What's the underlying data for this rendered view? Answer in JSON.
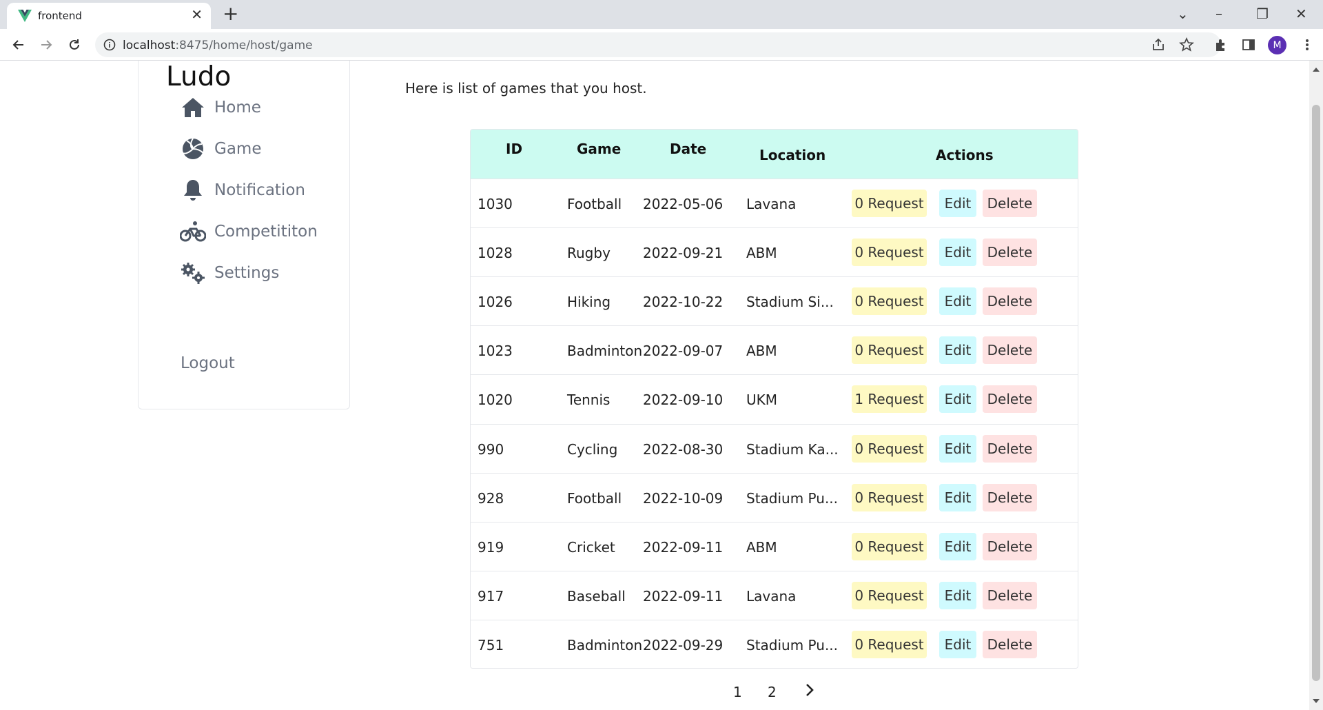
{
  "browser": {
    "tab_title": "frontend",
    "url_host": "localhost",
    "url_path": ":8475/home/host/game",
    "profile_initial": "M"
  },
  "sidebar": {
    "brand": "Ludo",
    "items": [
      {
        "label": "Home",
        "icon": "home-icon"
      },
      {
        "label": "Game",
        "icon": "volleyball-icon"
      },
      {
        "label": "Notification",
        "icon": "bell-icon"
      },
      {
        "label": "Competititon",
        "icon": "bicycle-icon"
      },
      {
        "label": "Settings",
        "icon": "gears-icon"
      }
    ],
    "logout": "Logout"
  },
  "main": {
    "intro": "Here is list of games that you host."
  },
  "table": {
    "headers": {
      "id": "ID",
      "game": "Game",
      "date": "Date",
      "location": "Location",
      "actions": "Actions"
    },
    "rows": [
      {
        "id": "1030",
        "game": "Football",
        "date": "2022-05-06",
        "location": "Lavana",
        "requests": "0 Request"
      },
      {
        "id": "1028",
        "game": "Rugby",
        "date": "2022-09-21",
        "location": "ABM",
        "requests": "0 Request"
      },
      {
        "id": "1026",
        "game": "Hiking",
        "date": "2022-10-22",
        "location": "Stadium Si...",
        "requests": "0 Request"
      },
      {
        "id": "1023",
        "game": "Badminton",
        "date": "2022-09-07",
        "location": "ABM",
        "requests": "0 Request"
      },
      {
        "id": "1020",
        "game": "Tennis",
        "date": "2022-09-10",
        "location": "UKM",
        "requests": "1 Request"
      },
      {
        "id": "990",
        "game": "Cycling",
        "date": "2022-08-30",
        "location": "Stadium Ka...",
        "requests": "0 Request"
      },
      {
        "id": "928",
        "game": "Football",
        "date": "2022-10-09",
        "location": "Stadium Pu...",
        "requests": "0 Request"
      },
      {
        "id": "919",
        "game": "Cricket",
        "date": "2022-09-11",
        "location": "ABM",
        "requests": "0 Request"
      },
      {
        "id": "917",
        "game": "Baseball",
        "date": "2022-09-11",
        "location": "Lavana",
        "requests": "0 Request"
      },
      {
        "id": "751",
        "game": "Badminton",
        "date": "2022-09-29",
        "location": "Stadium Pu...",
        "requests": "0 Request"
      }
    ],
    "edit_label": "Edit",
    "delete_label": "Delete"
  },
  "pagination": {
    "pages": [
      "1",
      "2"
    ],
    "next_icon": "chevron-right-icon"
  },
  "colors": {
    "header_bg": "#ccfbf1",
    "request_bg": "#fef9c3",
    "edit_bg": "#cffafe",
    "delete_bg": "#fee2e2",
    "nav_text": "#6b7280",
    "nav_icon": "#4b5563"
  }
}
